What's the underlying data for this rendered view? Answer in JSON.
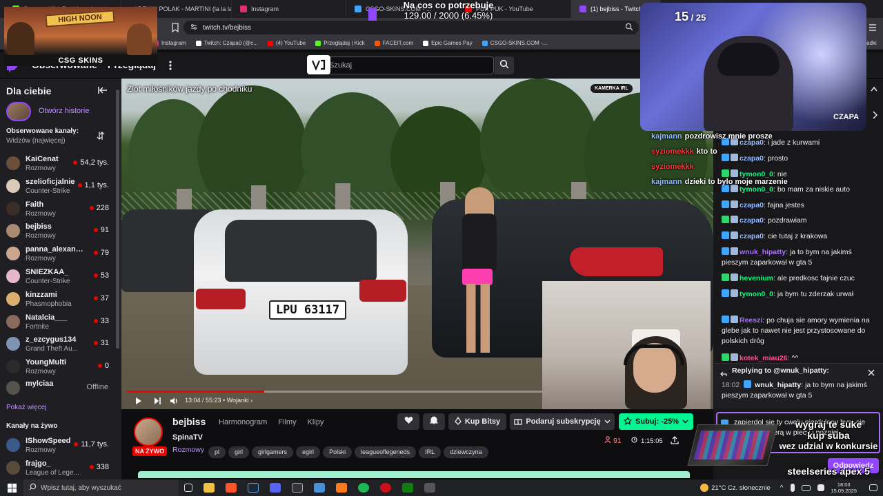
{
  "browser": {
    "tabs": [
      {
        "label": "Stream - Kick Dashboard",
        "color": "#53fc18"
      },
      {
        "label": "ADRIAN POLAK - MARTINI (la la la)",
        "color": "#ff0000"
      },
      {
        "label": "Instagram",
        "color": "#e1306c"
      },
      {
        "label": "CSGO-SKINS.COM - ...",
        "color": "#3ea6ff"
      },
      {
        "label": "PUK PUK - YouTube",
        "color": "#ff0000"
      },
      {
        "label": "(1) bejbiss - Twitch",
        "color": "#9146ff"
      }
    ],
    "url": "twitch.tv/bejbiss",
    "bookmarks": [
      {
        "label": "Instagram",
        "color": "#e1306c"
      },
      {
        "label": "Twitch: Czapa0 (@c...",
        "color": "#ffffff"
      },
      {
        "label": "(4) YouTube",
        "color": "#ff0000"
      },
      {
        "label": "Przeglądaj | Kick",
        "color": "#53fc18"
      },
      {
        "label": "FACEIT.com",
        "color": "#ff5500"
      },
      {
        "label": "Epic Games Pay",
        "color": "#ffffff"
      },
      {
        "label": "CSGO-SKINS.COM -...",
        "color": "#3ea6ff"
      }
    ],
    "bookmark_more": "adki"
  },
  "overlay": {
    "goal_title": "Na cos co potrzebuje",
    "goal_value": "129.00 / 2000 (6.45%)",
    "counter_value": "15",
    "counter_total": "25",
    "webcam_name": "CZAPA",
    "csgo_logo": "CSG SKINS",
    "high_noon": "HIGH NOON",
    "promo_lines": [
      "wygraj te suke",
      "kup suba",
      "wez udzial w konkursie",
      "steelseries apex 5"
    ],
    "irl_tag": "KAMERKA IRL"
  },
  "twitch_nav": {
    "following": "Obserwowane",
    "browse": "Przeglądaj",
    "search_placeholder": "Szukaj"
  },
  "sidebar": {
    "for_you": "Dla ciebie",
    "open_stories": "Otwórz historie",
    "followed_heading": "Obserwowane kanały:",
    "sort_label": "Widzów (najwięcej)",
    "channels": [
      {
        "name": "KaiCenat",
        "game": "Rozmowy",
        "viewers": "54,2 tys.",
        "color": "#6b4f3a"
      },
      {
        "name": "szelioficjalnie",
        "game": "Counter-Strike",
        "viewers": "1,1 tys.",
        "color": "#d8c9b8"
      },
      {
        "name": "Faith",
        "game": "Rozmowy",
        "viewers": "228",
        "color": "#3a2e28"
      },
      {
        "name": "bejbiss",
        "game": "Rozmowy",
        "viewers": "91",
        "color": "#a88a70"
      },
      {
        "name": "panna_alexandr...",
        "game": "Rozmowy",
        "viewers": "79",
        "color": "#caa590"
      },
      {
        "name": "SNIEZKAA_",
        "game": "Counter-Strike",
        "viewers": "53",
        "color": "#e3b8c8"
      },
      {
        "name": "kinzzami",
        "game": "Phasmophobia",
        "viewers": "37",
        "color": "#d9b070"
      },
      {
        "name": "Natalcia___",
        "game": "Fortnite",
        "viewers": "33",
        "color": "#8a6a5a"
      },
      {
        "name": "z_ezcygus134",
        "game": "Grand Theft Au...",
        "viewers": "31",
        "color": "#7e94b0"
      },
      {
        "name": "YoungMulti",
        "game": "Rozmowy",
        "viewers": "0",
        "color": "#2b2b2b"
      }
    ],
    "offline_channel": {
      "name": "mylciaa",
      "status": "Offline"
    },
    "show_more": "Pokaż więcej",
    "live_heading": "Kanały na żywo",
    "live_channels": [
      {
        "name": "IShowSpeed",
        "game": "Rozmowy",
        "viewers": "11,7 tys.",
        "color": "#3a5a8a"
      },
      {
        "name": "frajgo_",
        "game": "League of Lege...",
        "viewers": "338",
        "color": "#5a4a3a"
      }
    ]
  },
  "video": {
    "title_overlay": "Zlot miłośników jazdy po chodniku",
    "plate": "LPU 63117",
    "time": "13:04 / 55:23",
    "chapter": "Wojanki",
    "progress": 0.2364
  },
  "channel": {
    "name": "bejbiss",
    "tabs": [
      "Harmonogram",
      "Filmy",
      "Klipy"
    ],
    "stream_title": "SpinaTV",
    "live_badge": "NA ŻYWO",
    "category": "Rozmowy",
    "tags": [
      "pl",
      "girl",
      "girlgamers",
      "egirl",
      "Polski",
      "leagueoflegeneds",
      "IRL",
      "dziewczyna"
    ],
    "buy_bits": "Kup Bitsy",
    "gift_sub": "Podaruj subskrypcję",
    "subscribe": "Subuj: -25%",
    "viewers": "91",
    "uptime": "1:15:05"
  },
  "chat": {
    "overlay_messages": [
      {
        "user": "kajmann",
        "text": "pozdrowisz mnie prosze",
        "color": "#8fb8ff"
      },
      {
        "user": "syziomekkk",
        "text": "kto to",
        "color": "#ff3b3b"
      },
      {
        "user": "syziomekkk",
        "text": "",
        "color": "#ff3b3b"
      },
      {
        "user": "kajmann",
        "text": "dzieki to bylo moje marzenie",
        "color": "#8fb8ff"
      }
    ],
    "messages": [
      {
        "user": "czapa0",
        "text": "i jade z kurwami",
        "color": "#8fb8ff"
      },
      {
        "user": "czapa0",
        "text": "prosto",
        "color": "#8fb8ff"
      },
      {
        "user": "tymon0_0",
        "text": "nie",
        "color": "#00ff7f"
      },
      {
        "user": "tymon0_0",
        "text": "bo mam za niskie auto",
        "color": "#00ff7f"
      },
      {
        "user": "czapa0",
        "text": "fajna jestes",
        "color": "#8fb8ff"
      },
      {
        "user": "czapa0",
        "text": "pozdrawiam",
        "color": "#8fb8ff"
      },
      {
        "user": "czapa0",
        "text": "cie tutaj z krakowa",
        "color": "#8fb8ff"
      },
      {
        "user": "wnuk_hipatty",
        "text": "ja to bym na jakimś pieszym zaparkował w gta 5",
        "color": "#a970ff"
      },
      {
        "user": "hevenium",
        "text": "ale predkosc fajnie czuc",
        "color": "#00ff7f"
      },
      {
        "user": "tymon0_0",
        "text": "ja bym tu zderzak urwał",
        "color": "#00ff7f"
      },
      {
        "user": "Reeszi",
        "text": "po chuja sie amory wymienia na glebe jak to nawet nie jest przystosowane do polskich dróg",
        "color": "#a970ff"
      },
      {
        "user": "kotek_miau26",
        "text": "^^",
        "color": "#ff4f8b"
      }
    ],
    "reply_heading": "Replying to @wnuk_hipatty:",
    "reply_time": "18:02",
    "reply_user": "wnuk_hipatty",
    "reply_text": "ja to bym na jakimś pieszym zaparkował w gta 5",
    "input_text": "zapierdol sie ty cwelu pierdolony bym cie zajebał siekierą w piecy i pozniej",
    "reply_button": "Odpowiedz"
  },
  "taskbar": {
    "search_placeholder": "Wpisz tutaj, aby wyszukać",
    "weather": "21°C  Cz. słonecznie",
    "time": "18:03",
    "date": "15.09.2025"
  }
}
